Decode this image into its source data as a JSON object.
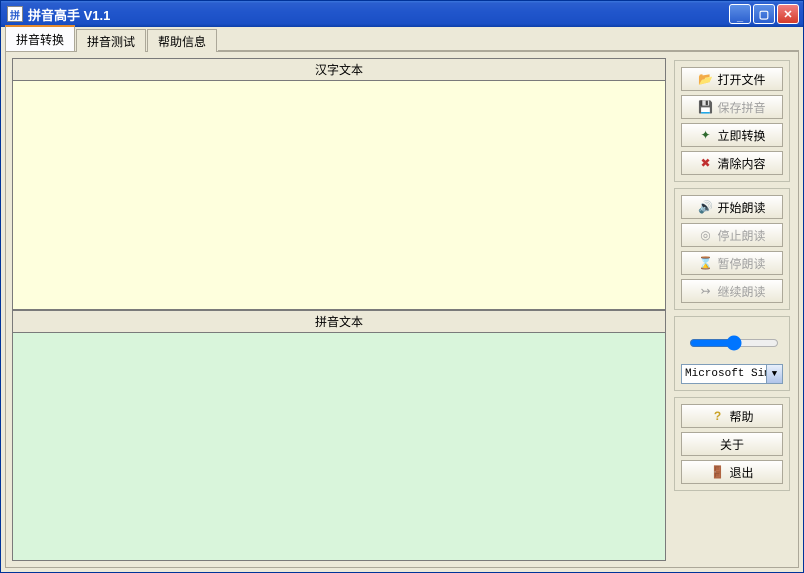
{
  "window": {
    "title": "拼音高手 V1.1"
  },
  "tabs": [
    {
      "label": "拼音转换",
      "active": true
    },
    {
      "label": "拼音测试",
      "active": false
    },
    {
      "label": "帮助信息",
      "active": false
    }
  ],
  "panels": {
    "hanzi": {
      "title": "汉字文本",
      "value": ""
    },
    "pinyin": {
      "title": "拼音文本",
      "value": ""
    }
  },
  "sidebar": {
    "group_file": {
      "open": {
        "label": "打开文件",
        "enabled": true
      },
      "save": {
        "label": "保存拼音",
        "enabled": false
      },
      "convert": {
        "label": "立即转换",
        "enabled": true
      },
      "clear": {
        "label": "清除内容",
        "enabled": true
      }
    },
    "group_read": {
      "start": {
        "label": "开始朗读",
        "enabled": true
      },
      "stop": {
        "label": "停止朗读",
        "enabled": false
      },
      "pause": {
        "label": "暂停朗读",
        "enabled": false
      },
      "resume": {
        "label": "继续朗读",
        "enabled": false
      }
    },
    "voice": {
      "slider_value": 50,
      "selected_voice": "Microsoft Simpl"
    },
    "group_misc": {
      "help": {
        "label": "帮助"
      },
      "about": {
        "label": "关于"
      },
      "exit": {
        "label": "退出"
      }
    }
  }
}
